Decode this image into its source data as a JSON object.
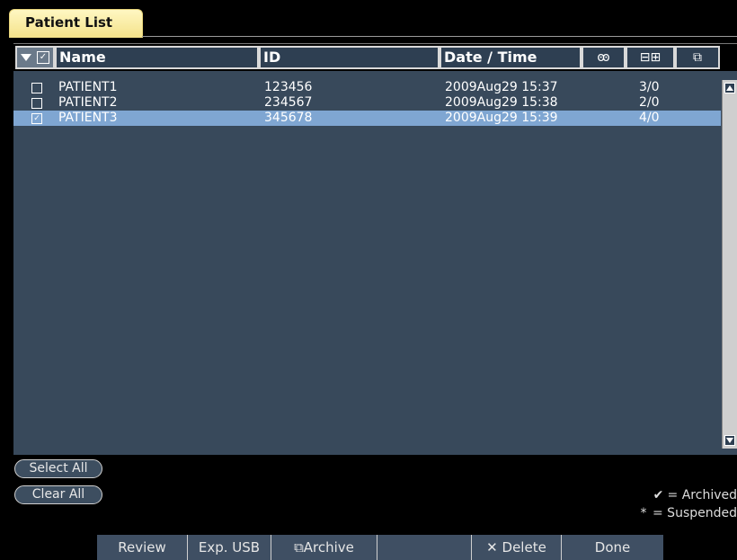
{
  "tab": {
    "title": "Patient List"
  },
  "columns": {
    "name": "Name",
    "id": "ID",
    "datetime": "Date / Time",
    "icon_person": "person-icon",
    "icon_study": "study-count-icon",
    "icon_archive": "archive-status-icon"
  },
  "rows": [
    {
      "checked": false,
      "name": "PATIENT1",
      "id": "123456",
      "datetime": "2009Aug29  15:37",
      "count": "3/0"
    },
    {
      "checked": false,
      "name": "PATIENT2",
      "id": "234567",
      "datetime": "2009Aug29  15:38",
      "count": "2/0"
    },
    {
      "checked": true,
      "name": "PATIENT3",
      "id": "345678",
      "datetime": "2009Aug29  15:39",
      "count": "4/0"
    }
  ],
  "buttons": {
    "select_all": "Select All",
    "clear_all": "Clear All",
    "review": "Review",
    "exp_usb": "Exp. USB",
    "archive": "Archive",
    "delete": "Delete",
    "done": "Done"
  },
  "legend": {
    "archived": "= Archived",
    "suspended": "= Suspended"
  },
  "colors": {
    "tab": "#f4e28a",
    "panel": "#38495b",
    "selected_row": "#7fa6d2"
  }
}
